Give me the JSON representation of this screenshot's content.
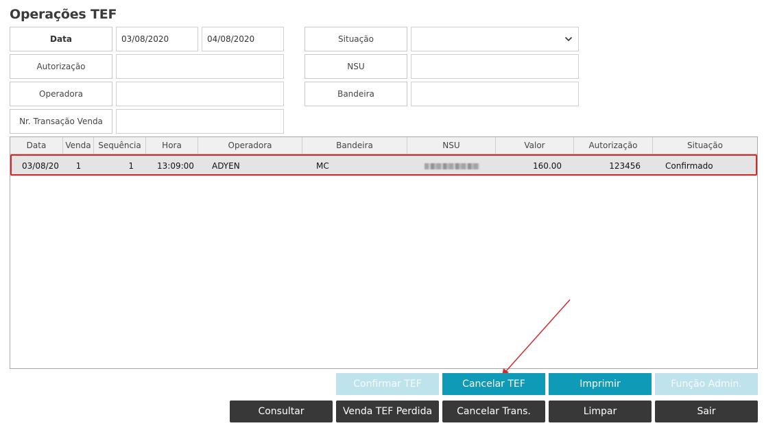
{
  "page": {
    "title": "Operações TEF"
  },
  "filters": {
    "data_label": "Data",
    "date_from": "03/08/2020",
    "date_to": "04/08/2020",
    "autorizacao_label": "Autorização",
    "autorizacao_value": "",
    "operadora_label": "Operadora",
    "operadora_value": "",
    "nr_transacao_label": "Nr. Transação Venda",
    "nr_transacao_value": "",
    "situacao_label": "Situação",
    "situacao_value": "",
    "nsu_label": "NSU",
    "nsu_value": "",
    "bandeira_label": "Bandeira",
    "bandeira_value": ""
  },
  "grid": {
    "columns": [
      "Data",
      "Venda",
      "Sequência",
      "Hora",
      "Operadora",
      "Bandeira",
      "NSU",
      "Valor",
      "Autorização",
      "Situação"
    ],
    "rows": [
      {
        "data": "03/08/20",
        "venda": "1",
        "sequencia": "1",
        "hora": "13:09:00",
        "operadora": "ADYEN",
        "bandeira": "MC",
        "nsu": "",
        "valor": "160.00",
        "autorizacao": "123456",
        "situacao": "Confirmado"
      }
    ]
  },
  "actions": {
    "confirmar_tef": "Confirmar TEF",
    "cancelar_tef": "Cancelar TEF",
    "imprimir": "Imprimir",
    "funcao_admin": "Função Admin.",
    "consultar": "Consultar",
    "venda_tef_perdida": "Venda TEF Perdida",
    "cancelar_trans": "Cancelar Trans.",
    "limpar": "Limpar",
    "sair": "Sair"
  },
  "colors": {
    "accent_teal": "#0f9ab8",
    "disabled_teal": "#bfe3ec",
    "dark_button": "#383838",
    "highlight_red": "#d42a2a"
  },
  "icons": {
    "dropdown": "chevron-down-icon"
  }
}
